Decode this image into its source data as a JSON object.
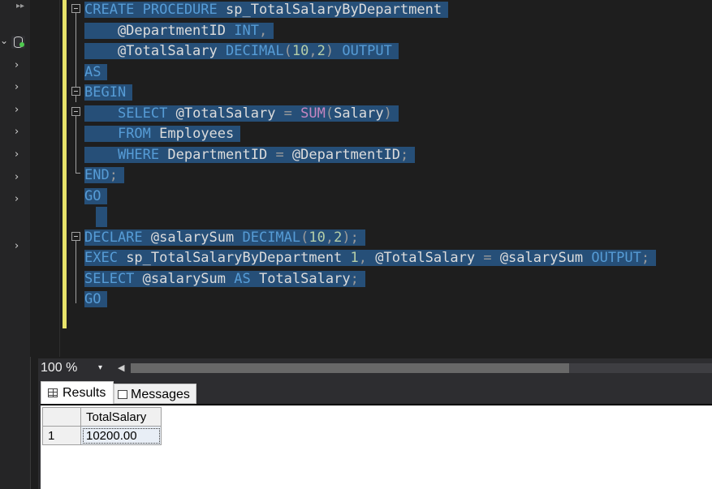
{
  "explorer": {
    "collapse_glyph": "▸▸",
    "db_caret": "⌄",
    "node_glyph": "›",
    "node_count": 9
  },
  "editor": {
    "lines": [
      {
        "tokens": [
          [
            "kw",
            "CREATE PROCEDURE"
          ],
          [
            "tx",
            " sp_TotalSalaryByDepartment"
          ]
        ]
      },
      {
        "tokens": [
          [
            "tx",
            "    @DepartmentID "
          ],
          [
            "kw",
            "INT"
          ],
          [
            "gr",
            ","
          ]
        ]
      },
      {
        "tokens": [
          [
            "tx",
            "    @TotalSalary "
          ],
          [
            "kw",
            "DECIMAL"
          ],
          [
            "gr",
            "("
          ],
          [
            "num",
            "10"
          ],
          [
            "gr",
            ","
          ],
          [
            "num",
            "2"
          ],
          [
            "gr",
            ")"
          ],
          [
            "tx",
            " "
          ],
          [
            "kw",
            "OUTPUT"
          ]
        ]
      },
      {
        "tokens": [
          [
            "kw",
            "AS"
          ]
        ]
      },
      {
        "tokens": [
          [
            "kw",
            "BEGIN"
          ]
        ]
      },
      {
        "tokens": [
          [
            "tx",
            "    "
          ],
          [
            "kw",
            "SELECT"
          ],
          [
            "tx",
            " @TotalSalary "
          ],
          [
            "gr",
            "="
          ],
          [
            "tx",
            " "
          ],
          [
            "fn",
            "SUM"
          ],
          [
            "gr",
            "("
          ],
          [
            "tx",
            "Salary"
          ],
          [
            "gr",
            ")"
          ]
        ]
      },
      {
        "tokens": [
          [
            "tx",
            "    "
          ],
          [
            "kw",
            "FROM"
          ],
          [
            "tx",
            " Employees"
          ]
        ]
      },
      {
        "tokens": [
          [
            "tx",
            "    "
          ],
          [
            "kw",
            "WHERE"
          ],
          [
            "tx",
            " DepartmentID "
          ],
          [
            "gr",
            "="
          ],
          [
            "tx",
            " @DepartmentID"
          ],
          [
            "gr",
            ";"
          ]
        ]
      },
      {
        "tokens": [
          [
            "kw",
            "END"
          ],
          [
            "gr",
            ";"
          ]
        ]
      },
      {
        "tokens": [
          [
            "kw",
            "GO"
          ]
        ]
      },
      {
        "tokens": []
      },
      {
        "tokens": [
          [
            "kw",
            "DECLARE"
          ],
          [
            "tx",
            " @salarySum "
          ],
          [
            "kw",
            "DECIMAL"
          ],
          [
            "gr",
            "("
          ],
          [
            "num",
            "10"
          ],
          [
            "gr",
            ","
          ],
          [
            "num",
            "2"
          ],
          [
            "gr",
            ");"
          ]
        ]
      },
      {
        "tokens": [
          [
            "kw",
            "EXEC"
          ],
          [
            "tx",
            " sp_TotalSalaryByDepartment "
          ],
          [
            "num",
            "1"
          ],
          [
            "gr",
            ","
          ],
          [
            "tx",
            " @TotalSalary "
          ],
          [
            "gr",
            "="
          ],
          [
            "tx",
            " @salarySum "
          ],
          [
            "kw",
            "OUTPUT"
          ],
          [
            "gr",
            ";"
          ]
        ]
      },
      {
        "tokens": [
          [
            "kw",
            "SELECT"
          ],
          [
            "tx",
            " @salarySum "
          ],
          [
            "kw",
            "AS"
          ],
          [
            "tx",
            " TotalSalary"
          ],
          [
            "gr",
            ";"
          ]
        ]
      },
      {
        "tokens": [
          [
            "kw",
            "GO"
          ]
        ]
      }
    ]
  },
  "zoom": {
    "value": "100 %",
    "caret": "▾",
    "scroll_left_glyph": "◀"
  },
  "results_panel": {
    "tabs": [
      {
        "label": "Results",
        "active": true
      },
      {
        "label": "Messages",
        "active": false
      }
    ],
    "grid": {
      "columns": [
        "TotalSalary"
      ],
      "rows": [
        {
          "rownum": "1",
          "cells": [
            "10200.00"
          ]
        }
      ]
    }
  },
  "colors": {
    "keyword": "#569cd6",
    "function": "#c586c0",
    "number": "#b5cea8",
    "selection": "#264f78",
    "change_bar": "#e8e36a"
  }
}
